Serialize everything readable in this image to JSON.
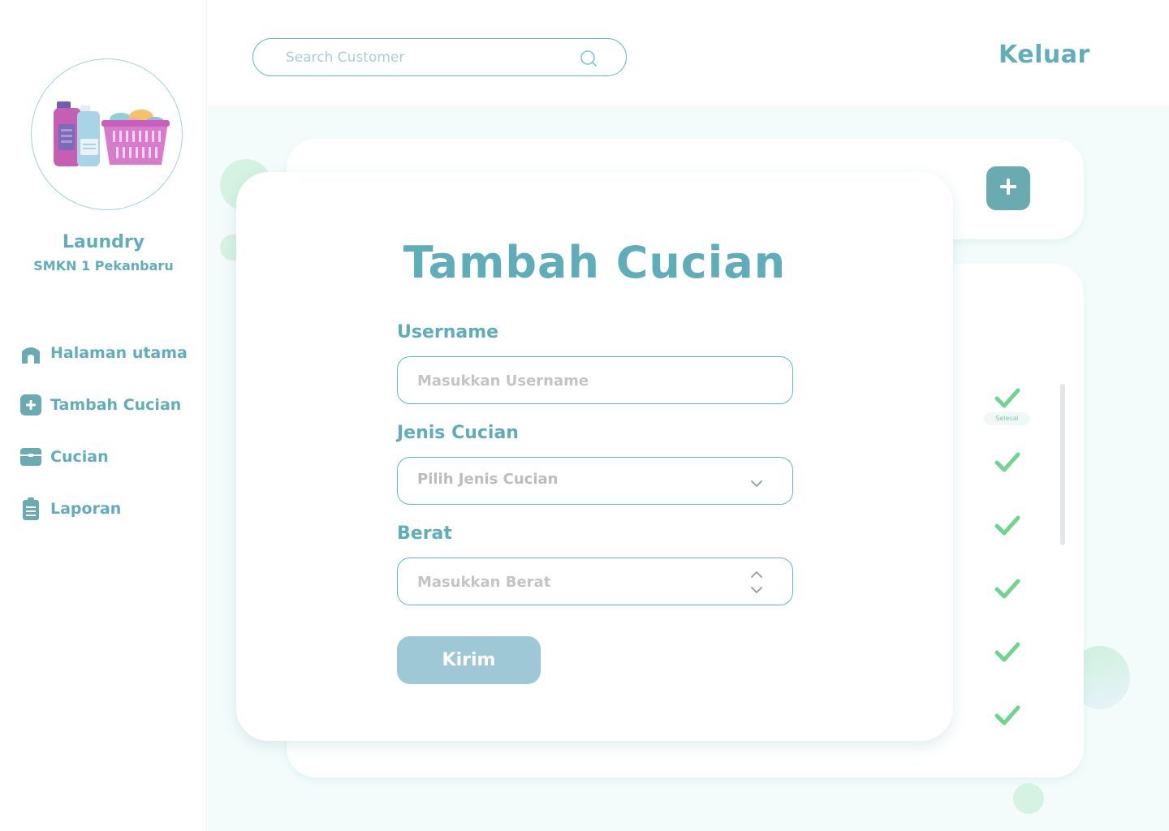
{
  "sidebar": {
    "brand_title": "Laundry",
    "brand_subtitle": "SMKN 1 Pekanbaru",
    "logo_icon": "laundry-basket-logo",
    "nav": [
      {
        "label": "Halaman utama",
        "icon": "home-icon"
      },
      {
        "label": "Tambah Cucian",
        "icon": "plus-square-icon"
      },
      {
        "label": "Cucian",
        "icon": "box-icon"
      },
      {
        "label": "Laporan",
        "icon": "clipboard-icon"
      }
    ]
  },
  "header": {
    "search_placeholder": "Search Customer",
    "search_icon": "search-icon",
    "logout_label": "Keluar"
  },
  "background": {
    "status_label": "Selesai",
    "check_count": 6,
    "check_icon": "check-icon",
    "add_icon": "plus-icon"
  },
  "modal": {
    "title": "Tambah Cucian",
    "username_label": "Username",
    "username_placeholder": "Masukkan Username",
    "type_label": "Jenis Cucian",
    "type_placeholder": "Pilih Jenis Cucian",
    "weight_label": "Berat",
    "weight_placeholder": "Masukkan Berat",
    "submit_label": "Kirim"
  },
  "colors": {
    "primary": "#62aeb8",
    "accent_button": "#6aabb2",
    "submit_button": "#9ec8d6",
    "check": "#6fd48f",
    "background": "#f4fcfb"
  }
}
